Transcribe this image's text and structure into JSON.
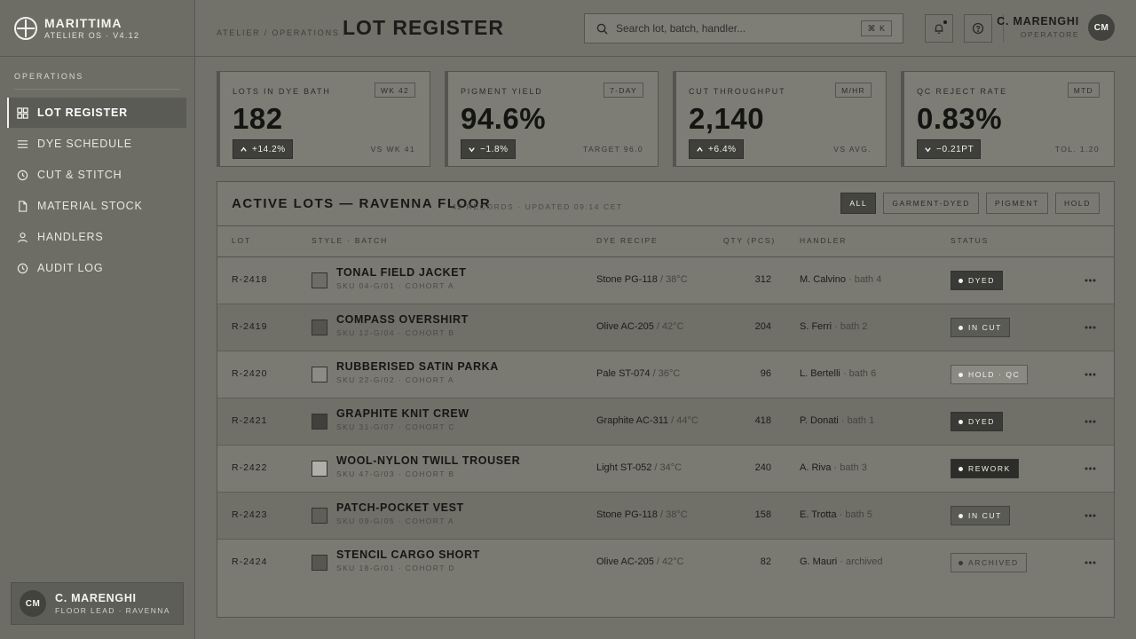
{
  "brand": {
    "name": "MARITTIMA",
    "sub": "ATELIER OS · V4.12"
  },
  "sidebar": {
    "section": "OPERATIONS",
    "items": [
      {
        "label": "LOT REGISTER",
        "icon": "grid-icon",
        "active": true
      },
      {
        "label": "DYE SCHEDULE",
        "icon": "list-icon"
      },
      {
        "label": "CUT & STITCH",
        "icon": "clock-icon"
      },
      {
        "label": "MATERIAL STOCK",
        "icon": "document-icon"
      },
      {
        "label": "HANDLERS",
        "icon": "user-icon"
      },
      {
        "label": "AUDIT LOG",
        "icon": "clock-icon"
      }
    ],
    "user": {
      "initials": "CM",
      "name": "C. MARENGHI",
      "role": "FLOOR LEAD · RAVENNA"
    }
  },
  "header": {
    "breadcrumb": "ATELIER / OPERATIONS /",
    "title": "LOT REGISTER",
    "search_placeholder": "Search lot, batch, handler...",
    "search_shortcut": "⌘ K",
    "user": {
      "name": "C. MARENGHI",
      "role": "OPERATORE",
      "initials": "CM"
    }
  },
  "stats": [
    {
      "label": "LOTS IN DYE BATH",
      "chip": "WK 42",
      "value": "182",
      "delta": "+14.2%",
      "direction": "up",
      "note": "VS WK 41"
    },
    {
      "label": "PIGMENT YIELD",
      "chip": "7-DAY",
      "value": "94.6%",
      "delta": "−1.8%",
      "direction": "down",
      "note": "TARGET 96.0"
    },
    {
      "label": "CUT THROUGHPUT",
      "chip": "M/HR",
      "value": "2,140",
      "delta": "+6.4%",
      "direction": "up",
      "note": "VS AVG."
    },
    {
      "label": "QC REJECT RATE",
      "chip": "MTD",
      "value": "0.83%",
      "delta": "−0.21PT",
      "direction": "down",
      "note": "TOL. 1.20"
    }
  ],
  "table": {
    "title": "ACTIVE LOTS — RAVENNA FLOOR",
    "meta": "42 RECORDS · UPDATED 09:14 CET",
    "filters": [
      "ALL",
      "GARMENT-DYED",
      "PIGMENT",
      "HOLD"
    ],
    "active_filter": "ALL",
    "columns": {
      "lot": "LOT",
      "style": "STYLE · BATCH",
      "recipe": "DYE RECIPE",
      "qty": "QTY (PCS)",
      "handler": "HANDLER",
      "status": "STATUS"
    },
    "rows": [
      {
        "lot": "R-2418",
        "swatch": "#6e6e67",
        "style": "TONAL FIELD JACKET",
        "sku": "SKU 04-G/01 · COHORT A",
        "recipe": "Stone PG-118",
        "temp": " / 38°C",
        "qty": "312",
        "handler": "M. Calvino",
        "detail": " · bath 4",
        "status": "DYED",
        "tone": "b-dark"
      },
      {
        "lot": "R-2419",
        "swatch": "#54544d",
        "style": "COMPASS OVERSHIRT",
        "sku": "SKU 12-G/04 · COHORT B",
        "recipe": "Olive AC-205",
        "temp": " / 42°C",
        "qty": "204",
        "handler": "S. Ferri",
        "detail": " · bath 2",
        "status": "IN CUT",
        "tone": "b-mid"
      },
      {
        "lot": "R-2420",
        "swatch": "#8c8c85",
        "style": "RUBBERISED SATIN PARKA",
        "sku": "SKU 22-G/02 · COHORT A",
        "recipe": "Pale ST-074",
        "temp": " / 36°C",
        "qty": "96",
        "handler": "L. Bertelli",
        "detail": " · bath 6",
        "status": "HOLD · QC",
        "tone": "b-light"
      },
      {
        "lot": "R-2421",
        "swatch": "#40403c",
        "style": "GRAPHITE KNIT CREW",
        "sku": "SKU 31-G/07 · COHORT C",
        "recipe": "Graphite AC-311",
        "temp": " / 44°C",
        "qty": "418",
        "handler": "P. Donati",
        "detail": " · bath 1",
        "status": "DYED",
        "tone": "b-dark"
      },
      {
        "lot": "R-2422",
        "swatch": "#b0b0a9",
        "style": "WOOL-NYLON TWILL TROUSER",
        "sku": "SKU 47-G/03 · COHORT B",
        "recipe": "Light ST-052",
        "temp": " / 34°C",
        "qty": "240",
        "handler": "A. Riva",
        "detail": " · bath 3",
        "status": "REWORK",
        "tone": "b-darkest"
      },
      {
        "lot": "R-2423",
        "swatch": "#5f5f58",
        "style": "PATCH-POCKET VEST",
        "sku": "SKU 09-G/05 · COHORT A",
        "recipe": "Stone PG-118",
        "temp": " / 38°C",
        "qty": "158",
        "handler": "E. Trotta",
        "detail": " · bath 5",
        "status": "IN CUT",
        "tone": "b-mid"
      },
      {
        "lot": "R-2424",
        "swatch": "#57574f",
        "style": "STENCIL CARGO SHORT",
        "sku": "SKU 18-G/01 · COHORT D",
        "recipe": "Olive AC-205",
        "temp": " / 42°C",
        "qty": "82",
        "handler": "G. Mauri",
        "detail": " · archived",
        "status": "ARCHIVED",
        "tone": "b-outline"
      }
    ]
  }
}
